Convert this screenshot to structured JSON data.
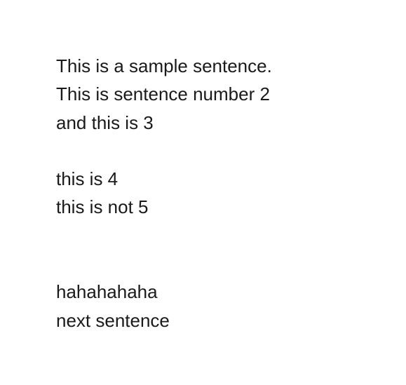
{
  "document": {
    "lines": [
      "This is a sample sentence.",
      "This is sentence number 2",
      "and this is 3",
      "",
      "this is 4",
      "this is not 5",
      "",
      "",
      "hahahahaha",
      "next sentence"
    ]
  }
}
